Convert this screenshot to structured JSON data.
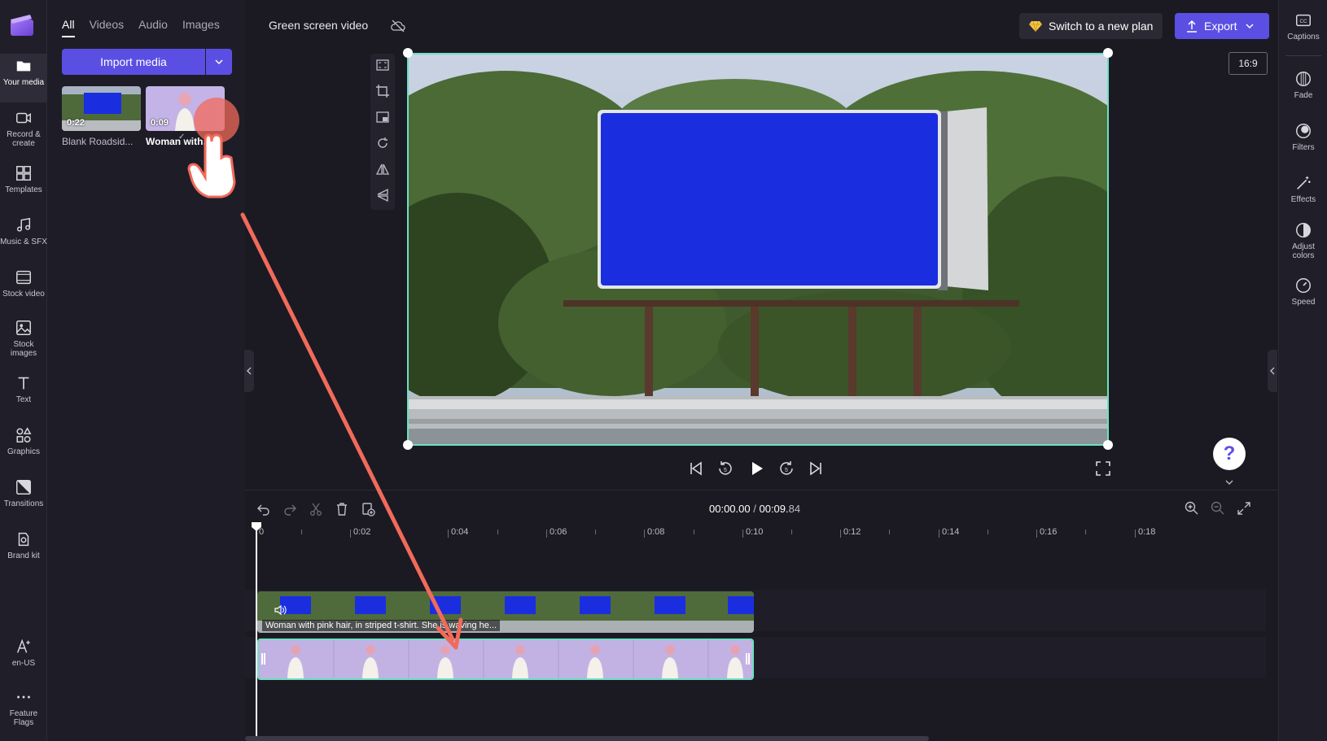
{
  "nav": {
    "items": [
      {
        "label": "Your media",
        "icon": "folder-icon"
      },
      {
        "label": "Record & create",
        "icon": "camera-icon"
      },
      {
        "label": "Templates",
        "icon": "templates-icon"
      },
      {
        "label": "Music & SFX",
        "icon": "music-icon"
      },
      {
        "label": "Stock video",
        "icon": "film-icon"
      },
      {
        "label": "Stock images",
        "icon": "image-icon"
      },
      {
        "label": "Text",
        "icon": "text-icon"
      },
      {
        "label": "Graphics",
        "icon": "shapes-icon"
      },
      {
        "label": "Transitions",
        "icon": "transitions-icon"
      },
      {
        "label": "Brand kit",
        "icon": "brand-kit-icon"
      }
    ],
    "bottom": [
      {
        "label": "en-US",
        "icon": "language-icon"
      },
      {
        "label": "Feature Flags",
        "icon": "more-icon"
      }
    ]
  },
  "media": {
    "tabs": [
      "All",
      "Videos",
      "Audio",
      "Images"
    ],
    "import_label": "Import media",
    "items": [
      {
        "duration": "0:22",
        "label": "Blank Roadsid..."
      },
      {
        "duration": "0:09",
        "label": "Woman with..."
      }
    ]
  },
  "header": {
    "project_title": "Green screen video",
    "plan_label": "Switch to a new plan",
    "export_label": "Export",
    "aspect_ratio": "16:9"
  },
  "properties": [
    {
      "label": "Captions",
      "icon": "captions-icon"
    },
    {
      "label": "Fade",
      "icon": "fade-icon"
    },
    {
      "label": "Filters",
      "icon": "filters-icon"
    },
    {
      "label": "Effects",
      "icon": "effects-icon"
    },
    {
      "label": "Adjust colors",
      "icon": "adjust-colors-icon"
    },
    {
      "label": "Speed",
      "icon": "speed-icon"
    }
  ],
  "playback": {
    "current_time": "00:00.00",
    "separator": "/",
    "total_time_main": "00:09.",
    "total_time_frac": "84"
  },
  "timeline": {
    "ruler_labels": [
      "0",
      "0:02",
      "0:04",
      "0:06",
      "0:08",
      "0:10",
      "0:12",
      "0:14",
      "0:16",
      "0:18"
    ],
    "clip_label": "Woman with pink hair, in striped t-shirt. She is waving he..."
  },
  "help_label": "?",
  "colors": {
    "accent": "#5b4fe3",
    "selection": "#6ee0c0",
    "arrow": "#f26a5a",
    "chroma_blue": "#1a2ee0"
  }
}
